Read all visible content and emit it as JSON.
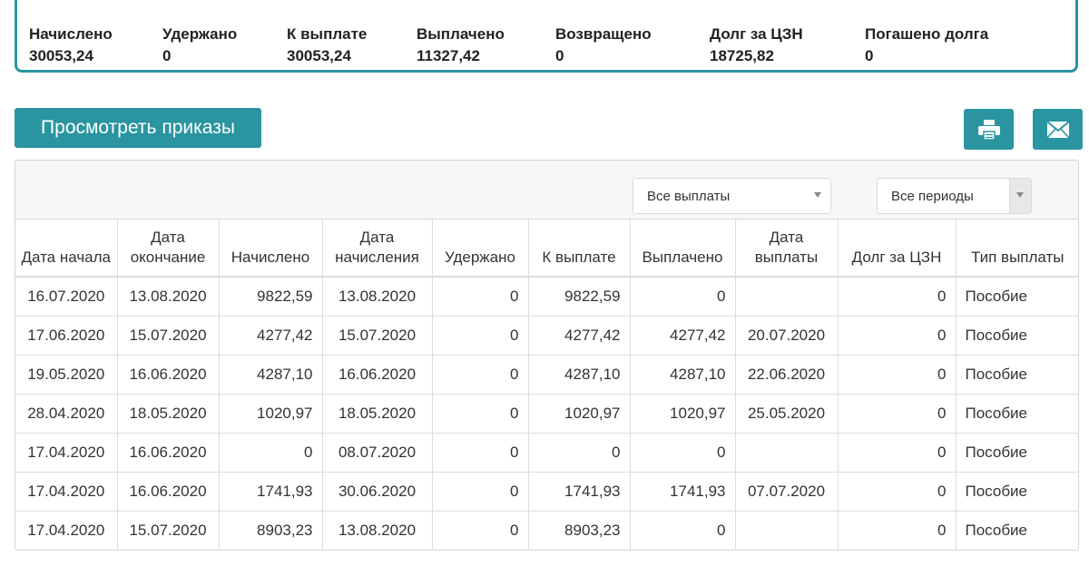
{
  "summary": [
    {
      "label": "Начислено",
      "value": "30053,24"
    },
    {
      "label": "Удержано",
      "value": "0"
    },
    {
      "label": "К выплате",
      "value": "30053,24"
    },
    {
      "label": "Выплачено",
      "value": "11327,42"
    },
    {
      "label": "Возвращено",
      "value": "0"
    },
    {
      "label": "Долг за ЦЗН",
      "value": "18725,82"
    },
    {
      "label": "Погашено долга",
      "value": "0"
    }
  ],
  "actions": {
    "view_orders_label": "Просмотреть приказы",
    "print_icon": "printer-icon",
    "mail_icon": "envelope-icon",
    "accent_color": "#2a95a0"
  },
  "filters": {
    "payments_selected": "Все выплаты",
    "periods_selected": "Все периоды"
  },
  "table": {
    "headers": [
      "Дата начала",
      "Дата окончание",
      "Начислено",
      "Дата начисления",
      "Удержано",
      "К выплате",
      "Выплачено",
      "Дата выплаты",
      "Долг за ЦЗН",
      "Тип выплаты"
    ],
    "rows": [
      [
        "16.07.2020",
        "13.08.2020",
        "9822,59",
        "13.08.2020",
        "0",
        "9822,59",
        "0",
        "",
        "0",
        "Пособие"
      ],
      [
        "17.06.2020",
        "15.07.2020",
        "4277,42",
        "15.07.2020",
        "0",
        "4277,42",
        "4277,42",
        "20.07.2020",
        "0",
        "Пособие"
      ],
      [
        "19.05.2020",
        "16.06.2020",
        "4287,10",
        "16.06.2020",
        "0",
        "4287,10",
        "4287,10",
        "22.06.2020",
        "0",
        "Пособие"
      ],
      [
        "28.04.2020",
        "18.05.2020",
        "1020,97",
        "18.05.2020",
        "0",
        "1020,97",
        "1020,97",
        "25.05.2020",
        "0",
        "Пособие"
      ],
      [
        "17.04.2020",
        "16.06.2020",
        "0",
        "08.07.2020",
        "0",
        "0",
        "0",
        "",
        "0",
        "Пособие"
      ],
      [
        "17.04.2020",
        "16.06.2020",
        "1741,93",
        "30.06.2020",
        "0",
        "1741,93",
        "1741,93",
        "07.07.2020",
        "0",
        "Пособие"
      ],
      [
        "17.04.2020",
        "15.07.2020",
        "8903,23",
        "13.08.2020",
        "0",
        "8903,23",
        "0",
        "",
        "0",
        "Пособие"
      ]
    ]
  }
}
